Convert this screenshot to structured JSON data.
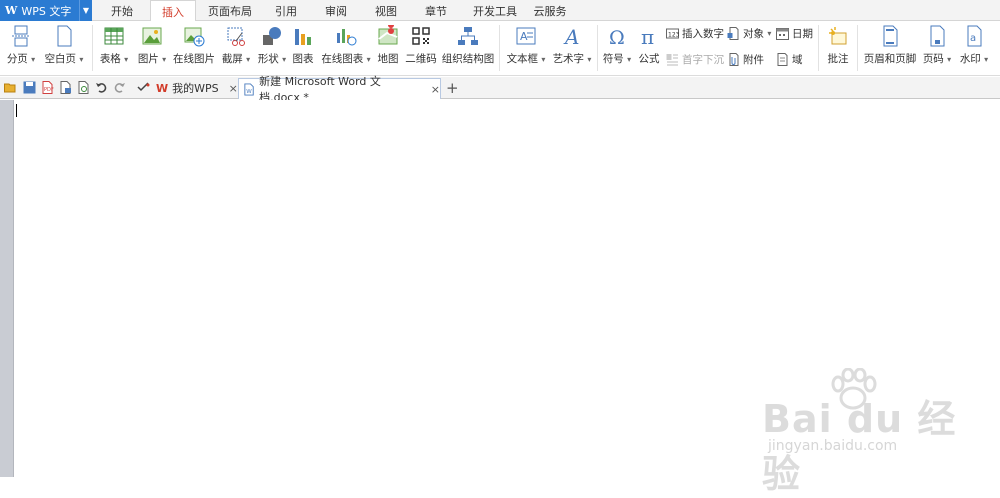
{
  "app": {
    "name": "WPS 文字",
    "logo": "W"
  },
  "menu_tabs": [
    {
      "label": "开始"
    },
    {
      "label": "插入"
    },
    {
      "label": "页面布局"
    },
    {
      "label": "引用"
    },
    {
      "label": "审阅"
    },
    {
      "label": "视图"
    },
    {
      "label": "章节"
    },
    {
      "label": "开发工具"
    },
    {
      "label": "云服务"
    }
  ],
  "active_tab": "插入",
  "ribbon": {
    "page_break": "分页",
    "blank_page": "空白页",
    "table": "表格",
    "picture": "图片",
    "online_picture": "在线图片",
    "screenshot": "截屏",
    "shapes": "形状",
    "chart": "图表",
    "online_chart": "在线图表",
    "map": "地图",
    "qrcode": "二维码",
    "org_chart": "组织结构图",
    "textbox": "文本框",
    "wordart": "艺术字",
    "symbol": "符号",
    "formula": "公式",
    "insert_number": "插入数字",
    "object": "对象",
    "date": "日期",
    "drop_cap": "首字下沉",
    "attachment": "附件",
    "field": "域",
    "comment": "批注",
    "header_footer": "页眉和页脚",
    "page_number": "页码",
    "watermark": "水印"
  },
  "doc_tabs": [
    {
      "label": "我的WPS"
    },
    {
      "label": "新建 Microsoft Word 文档.docx *"
    }
  ],
  "watermark": {
    "brand": "Bai du 经验",
    "sub": "jingyan.baidu.com"
  },
  "colors": {
    "accent": "#2b7bd2",
    "active_tab_text": "#d23c2a"
  }
}
